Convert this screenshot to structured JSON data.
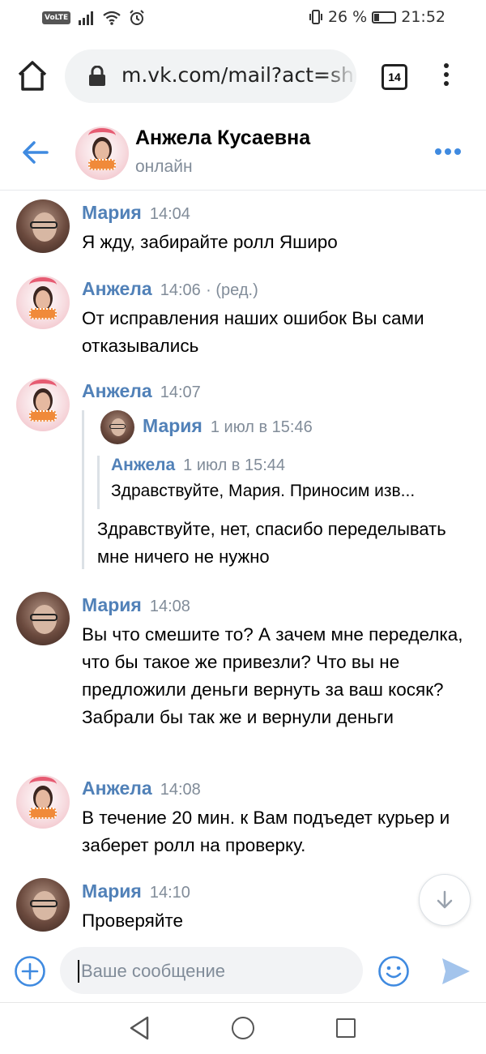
{
  "status_bar": {
    "volte": "VoLTE",
    "battery": "26 %",
    "time": "21:52",
    "battery_level": 0.26
  },
  "browser": {
    "url": "m.vk.com/mail?act=sh",
    "tab_count": "14"
  },
  "chat": {
    "name": "Анжела Кусаевна",
    "status": "онлайн"
  },
  "messages": [
    {
      "author": "Мария",
      "time": "14:04",
      "text": "Я жду, забирайте ролл Яширо"
    },
    {
      "author": "Анжела",
      "time": "14:06",
      "edited": "· (ред.)",
      "text": "От исправления наших ошибок Вы сами отказывались"
    },
    {
      "author": "Анжела",
      "time": "14:07",
      "forwarded": {
        "author": "Мария",
        "time": "1 июл в 15:46",
        "inner": {
          "author": "Анжела",
          "time": "1 июл в 15:44",
          "text": "Здравствуйте, Мария. Приносим изв..."
        },
        "text": "Здравствуйте, нет, спасибо переделывать мне ничего не нужно"
      }
    },
    {
      "author": "Мария",
      "time": "14:08",
      "text": "Вы что смешите то? А зачем мне переделка, что бы такое же привезли? Что вы не предложили деньги вернуть за ваш косяк? Забрали бы так же и вернули деньги"
    },
    {
      "author": "Анжела",
      "time": "14:08",
      "text": "В течение 20 мин. к Вам подъедет курьер и заберет ролл на проверку."
    },
    {
      "author": "Мария",
      "time": "14:10",
      "text": "Проверяйте"
    }
  ],
  "composer": {
    "placeholder": "Ваше сообщение"
  },
  "colors": {
    "vk_blue": "#5181b8",
    "accent": "#3f8ae0",
    "meta": "#818c99"
  }
}
